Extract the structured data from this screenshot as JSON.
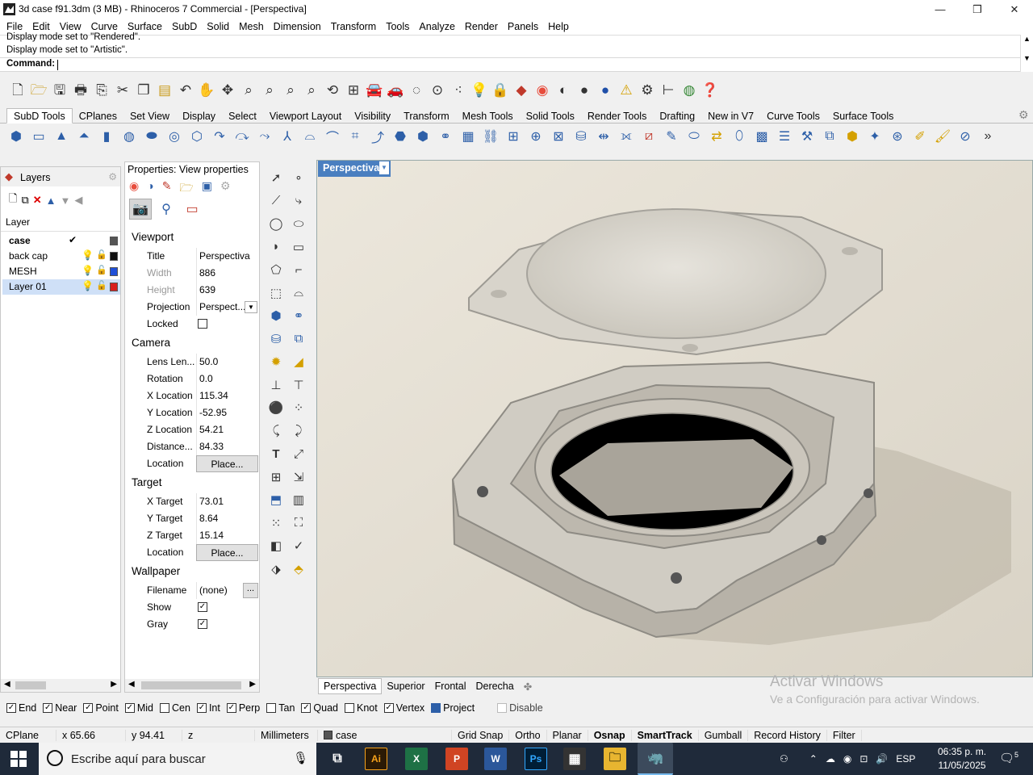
{
  "window": {
    "title": "3d case f91.3dm (3 MB) - Rhinoceros 7 Commercial - [Perspectiva]",
    "minimize": "—",
    "maximize": "❒",
    "close": "✕"
  },
  "menu": [
    "File",
    "Edit",
    "View",
    "Curve",
    "Surface",
    "SubD",
    "Solid",
    "Mesh",
    "Dimension",
    "Transform",
    "Tools",
    "Analyze",
    "Render",
    "Panels",
    "Help"
  ],
  "command": {
    "history": [
      "Display mode set to \"Rendered\".",
      "Display mode set to \"Artistic\"."
    ],
    "prompt": "Command:"
  },
  "toolbar_tabs": [
    "SubD Tools",
    "CPlanes",
    "Set View",
    "Display",
    "Select",
    "Viewport Layout",
    "Visibility",
    "Transform",
    "Mesh Tools",
    "Solid Tools",
    "Render Tools",
    "Drafting",
    "New in V7",
    "Curve Tools",
    "Surface Tools"
  ],
  "layers": {
    "title": "Layers",
    "column_header": "Layer",
    "rows": [
      {
        "name": "case",
        "current": true,
        "check": "✔",
        "color": "#555555"
      },
      {
        "name": "back cap",
        "current": false,
        "color": "#111111"
      },
      {
        "name": "MESH",
        "current": false,
        "color": "#1f4fd8"
      },
      {
        "name": "Layer 01",
        "current": false,
        "selected": true,
        "color": "#d81f1f"
      }
    ]
  },
  "properties": {
    "title": "Properties: View properties",
    "sections": {
      "viewport": "Viewport",
      "camera": "Camera",
      "target": "Target",
      "wallpaper": "Wallpaper"
    },
    "viewport": {
      "title_label": "Title",
      "title_value": "Perspectiva",
      "width_label": "Width",
      "width_value": "886",
      "height_label": "Height",
      "height_value": "639",
      "projection_label": "Projection",
      "projection_value": "Perspect...",
      "locked_label": "Locked"
    },
    "camera": {
      "lens_label": "Lens Len...",
      "lens_value": "50.0",
      "rotation_label": "Rotation",
      "rotation_value": "0.0",
      "xloc_label": "X Location",
      "xloc_value": "115.34",
      "yloc_label": "Y Location",
      "yloc_value": "-52.95",
      "zloc_label": "Z Location",
      "zloc_value": "54.21",
      "dist_label": "Distance...",
      "dist_value": "84.33",
      "location_label": "Location",
      "place_button": "Place..."
    },
    "target": {
      "x_label": "X Target",
      "x_value": "73.01",
      "y_label": "Y Target",
      "y_value": "8.64",
      "z_label": "Z Target",
      "z_value": "15.14",
      "location_label": "Location",
      "place_button": "Place..."
    },
    "wallpaper": {
      "filename_label": "Filename",
      "filename_value": "(none)",
      "browse": "...",
      "show_label": "Show",
      "show_checked": true,
      "gray_label": "Gray",
      "gray_checked": true
    }
  },
  "viewport": {
    "active_tab": "Perspectiva",
    "tabs": [
      "Perspectiva",
      "Superior",
      "Frontal",
      "Derecha"
    ],
    "add": "✤"
  },
  "watermark": {
    "line1": "Activar Windows",
    "line2": "Ve a Configuración para activar Windows."
  },
  "osnaps": [
    {
      "label": "End",
      "checked": true
    },
    {
      "label": "Near",
      "checked": true
    },
    {
      "label": "Point",
      "checked": true
    },
    {
      "label": "Mid",
      "checked": true
    },
    {
      "label": "Cen",
      "checked": false
    },
    {
      "label": "Int",
      "checked": true
    },
    {
      "label": "Perp",
      "checked": true
    },
    {
      "label": "Tan",
      "checked": false
    },
    {
      "label": "Quad",
      "checked": true
    },
    {
      "label": "Knot",
      "checked": false
    },
    {
      "label": "Vertex",
      "checked": true
    },
    {
      "label": "Project",
      "checked": false
    },
    {
      "label": "Disable",
      "checked": false
    }
  ],
  "status": {
    "cplane": "CPlane",
    "x": "x 65.66",
    "y": "y 94.41",
    "z": "z",
    "units": "Millimeters",
    "layer": "case",
    "grid_snap": "Grid Snap",
    "ortho": "Ortho",
    "planar": "Planar",
    "osnap": "Osnap",
    "smarttrack": "SmartTrack",
    "gumball": "Gumball",
    "record_history": "Record History",
    "filter": "Filter"
  },
  "taskbar": {
    "search_placeholder": "Escribe aquí para buscar",
    "language": "ESP",
    "time": "06:35 p. m.",
    "date": "11/05/2025",
    "notifications": "5"
  }
}
